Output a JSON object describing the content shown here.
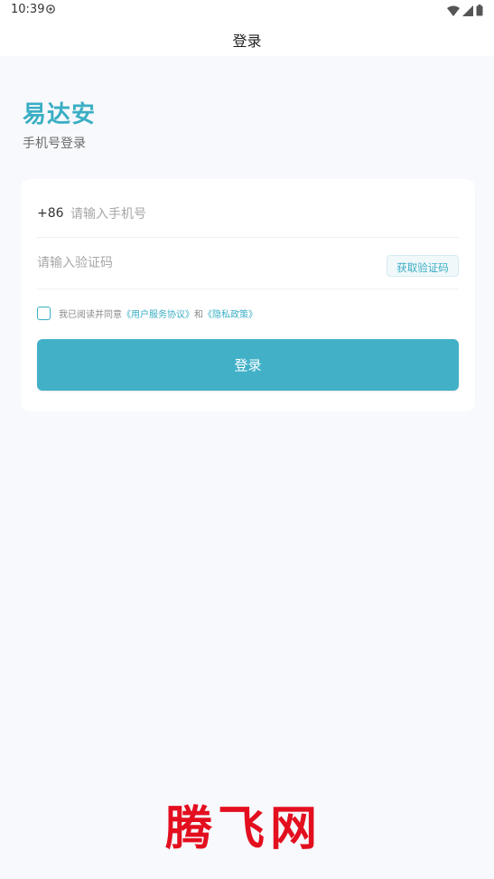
{
  "status_bar": {
    "time": "10:39"
  },
  "nav": {
    "title": "登录"
  },
  "brand": {
    "title": "易达安",
    "subtitle": "手机号登录"
  },
  "login_form": {
    "country_code": "+86",
    "phone_placeholder": "请输入手机号",
    "code_placeholder": "请输入验证码",
    "get_code_button": "获取验证码",
    "agreement": {
      "prefix": "我已阅读并同意",
      "user_agreement": "《用户服务协议》",
      "conjunction": "和",
      "privacy_policy": "《隐私政策》"
    },
    "login_button": "登录"
  },
  "watermark": {
    "text": "腾飞网"
  },
  "colors": {
    "accent": "#42b1c8",
    "brand": "#3aaec4",
    "watermark": "#e30f1f"
  }
}
